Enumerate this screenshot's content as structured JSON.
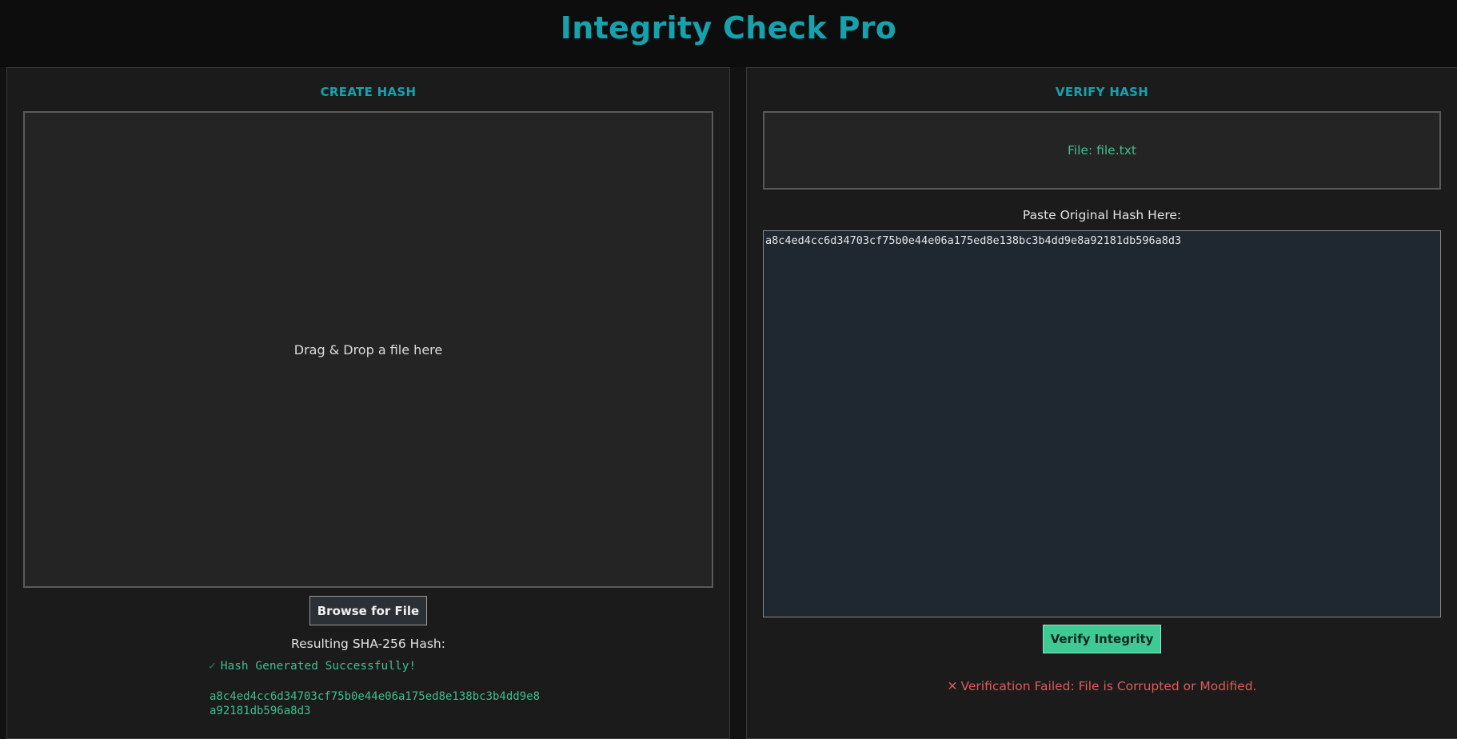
{
  "app": {
    "title": "Integrity Check Pro"
  },
  "create": {
    "title": "CREATE HASH",
    "dropzone_text": "Drag & Drop a file here",
    "browse_label": "Browse for File",
    "result_label": "Resulting SHA-256 Hash:",
    "success_icon": "✓",
    "success_text": "Hash Generated Successfully!",
    "hash_value": "a8c4ed4cc6d34703cf75b0e44e06a175ed8e138bc3b4dd9e8a92181db596a8d3"
  },
  "verify": {
    "title": "VERIFY HASH",
    "file_label": "File: file.txt",
    "paste_label": "Paste Original Hash Here:",
    "hash_input_value": "a8c4ed4cc6d34703cf75b0e44e06a175ed8e138bc3b4dd9e8a92181db596a8d3",
    "verify_label": "Verify Integrity",
    "status_icon": "✕",
    "status_text": "Verification Failed: File is Corrupted or Modified."
  },
  "colors": {
    "accent": "#16a2ad",
    "success": "#3fbf8f",
    "error": "#e05a5a",
    "button_green": "#3ec995"
  }
}
